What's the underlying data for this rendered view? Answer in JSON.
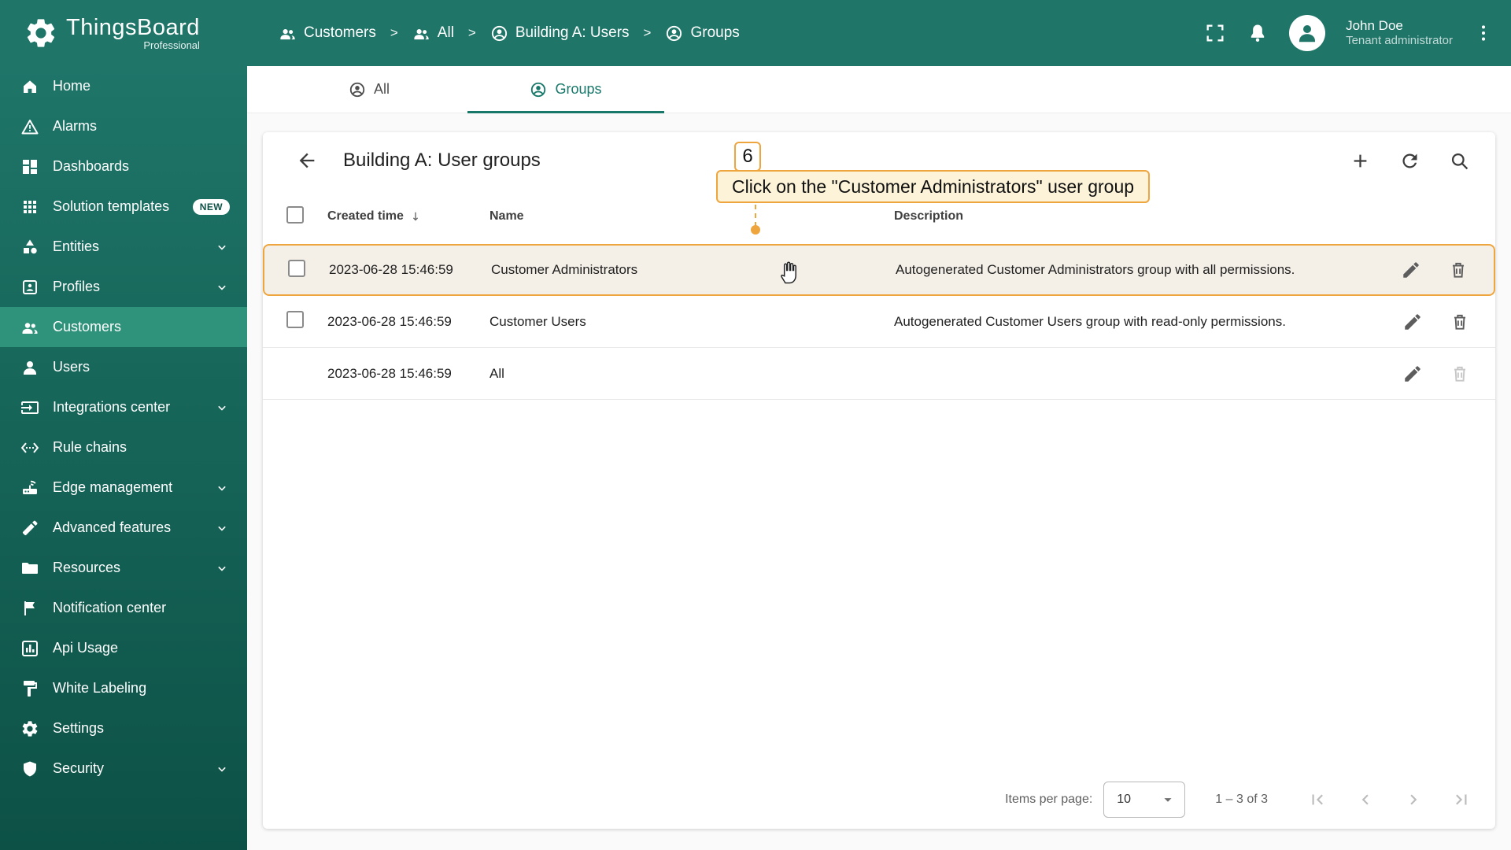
{
  "app": {
    "name": "ThingsBoard",
    "edition": "Professional"
  },
  "header": {
    "breadcrumb": [
      {
        "label": "Customers"
      },
      {
        "label": "All"
      },
      {
        "label": "Building A: Users"
      },
      {
        "label": "Groups"
      }
    ],
    "separator": ">",
    "user": {
      "name": "John Doe",
      "role": "Tenant administrator"
    }
  },
  "sidebar": {
    "items": [
      {
        "label": "Home"
      },
      {
        "label": "Alarms"
      },
      {
        "label": "Dashboards"
      },
      {
        "label": "Solution templates",
        "badge": "NEW"
      },
      {
        "label": "Entities"
      },
      {
        "label": "Profiles"
      },
      {
        "label": "Customers"
      },
      {
        "label": "Users"
      },
      {
        "label": "Integrations center"
      },
      {
        "label": "Rule chains"
      },
      {
        "label": "Edge management"
      },
      {
        "label": "Advanced features"
      },
      {
        "label": "Resources"
      },
      {
        "label": "Notification center"
      },
      {
        "label": "Api Usage"
      },
      {
        "label": "White Labeling"
      },
      {
        "label": "Settings"
      },
      {
        "label": "Security"
      }
    ]
  },
  "tabs": [
    {
      "label": "All"
    },
    {
      "label": "Groups"
    }
  ],
  "page": {
    "title": "Building A: User groups"
  },
  "table": {
    "columns": {
      "created": "Created time",
      "name": "Name",
      "description": "Description"
    },
    "rows": [
      {
        "created": "2023-06-28 15:46:59",
        "name": "Customer Administrators",
        "description": "Autogenerated Customer Administrators group with all permissions."
      },
      {
        "created": "2023-06-28 15:46:59",
        "name": "Customer Users",
        "description": "Autogenerated Customer Users group with read-only permissions."
      },
      {
        "created": "2023-06-28 15:46:59",
        "name": "All",
        "description": ""
      }
    ]
  },
  "tutorial": {
    "step": "6",
    "text": "Click on the \"Customer Administrators\" user group"
  },
  "paginator": {
    "items_per_page_label": "Items per page:",
    "items_per_page": "10",
    "range": "1 – 3 of 3"
  },
  "colors": {
    "primary": "#1e7568",
    "accent": "#efa53e"
  }
}
